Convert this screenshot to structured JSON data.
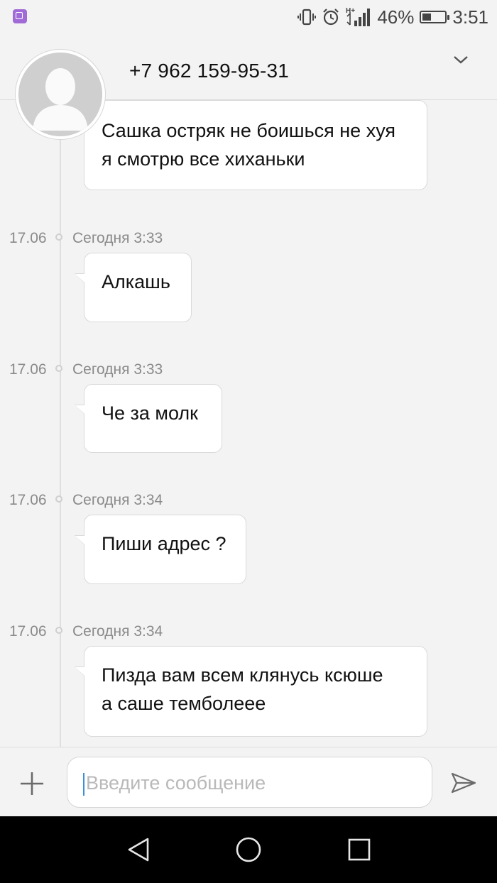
{
  "status_bar": {
    "battery_percent": "46%",
    "battery_level": 0.46,
    "time": "3:51",
    "network": "H+",
    "icons": [
      "gallery-icon",
      "vibrate-icon",
      "alarm-icon",
      "signal-icon",
      "battery-icon"
    ]
  },
  "header": {
    "contact": "+7 962 159-95-31",
    "dropdown_icon": "chevron-down-icon",
    "avatar_icon": "person-placeholder-icon"
  },
  "messages": [
    {
      "text": "Сашка остряк не боишься не хуя\nя смотрю все хиханьки"
    },
    {
      "date": "17.06",
      "time": "Сегодня 3:33",
      "text": "Алкашь"
    },
    {
      "date": "17.06",
      "time": "Сегодня 3:33",
      "text": "Че за молк"
    },
    {
      "date": "17.06",
      "time": "Сегодня 3:34",
      "text": "Пиши адрес ?"
    },
    {
      "date": "17.06",
      "time": "Сегодня 3:34",
      "text": "Пизда вам всем клянусь ксюше\nа саше темболеее"
    }
  ],
  "composer": {
    "placeholder": "Введите сообщение",
    "value": "",
    "add_icon": "plus-icon",
    "send_icon": "send-icon"
  },
  "nav_bar": {
    "icons": [
      "back-icon",
      "home-icon",
      "recent-apps-icon"
    ]
  },
  "colors": {
    "background": "#f3f3f3",
    "bubble": "#ffffff",
    "meta_text": "#8a8a8a",
    "caret": "#3a8fd6",
    "status_app_icon": "#a06bd6"
  }
}
